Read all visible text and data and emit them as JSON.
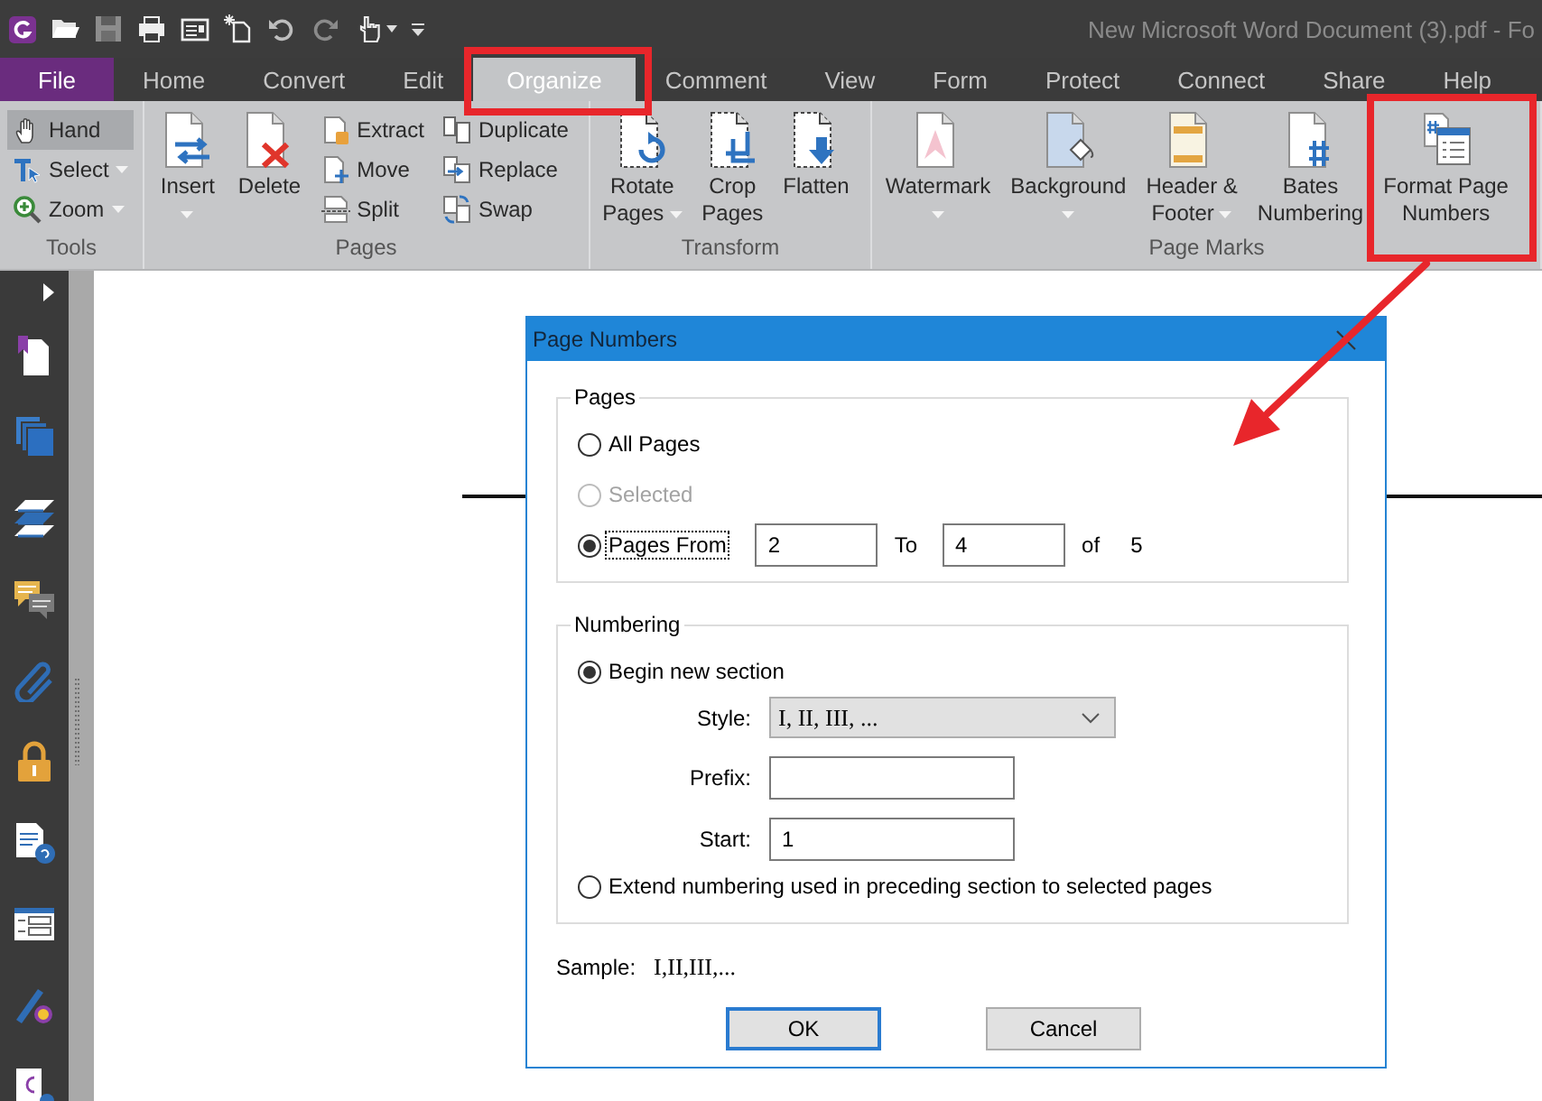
{
  "window": {
    "title": "New Microsoft Word Document (3).pdf - Fo"
  },
  "menu_tabs": [
    {
      "label": "File",
      "kind": "file",
      "selected": false
    },
    {
      "label": "Home",
      "kind": "tab",
      "selected": false
    },
    {
      "label": "Convert",
      "kind": "tab",
      "selected": false
    },
    {
      "label": "Edit",
      "kind": "tab",
      "selected": false
    },
    {
      "label": "Organize",
      "kind": "tab",
      "selected": true
    },
    {
      "label": "Comment",
      "kind": "tab",
      "selected": false
    },
    {
      "label": "View",
      "kind": "tab",
      "selected": false
    },
    {
      "label": "Form",
      "kind": "tab",
      "selected": false
    },
    {
      "label": "Protect",
      "kind": "tab",
      "selected": false
    },
    {
      "label": "Connect",
      "kind": "tab",
      "selected": false
    },
    {
      "label": "Share",
      "kind": "tab",
      "selected": false
    },
    {
      "label": "Help",
      "kind": "tab",
      "selected": false
    }
  ],
  "ribbon": {
    "groups": [
      {
        "label": "Tools",
        "items": [
          {
            "kind": "small",
            "label": "Hand",
            "selected": true
          },
          {
            "kind": "small",
            "label": "Select",
            "selected": false,
            "dropdown": true
          },
          {
            "kind": "small",
            "label": "Zoom",
            "selected": false,
            "dropdown": true
          }
        ]
      },
      {
        "label": "Pages",
        "items": [
          {
            "kind": "large",
            "lines": [
              "Insert"
            ],
            "dropdown": true
          },
          {
            "kind": "large",
            "lines": [
              "Delete"
            ]
          },
          {
            "kind": "small",
            "label": "Extract"
          },
          {
            "kind": "small",
            "label": "Move"
          },
          {
            "kind": "small",
            "label": "Split"
          },
          {
            "kind": "small",
            "label": "Duplicate"
          },
          {
            "kind": "small",
            "label": "Replace"
          },
          {
            "kind": "small",
            "label": "Swap"
          }
        ]
      },
      {
        "label": "Transform",
        "items": [
          {
            "kind": "large",
            "lines": [
              "Rotate",
              "Pages"
            ],
            "dropdown": true
          },
          {
            "kind": "large",
            "lines": [
              "Crop",
              "Pages"
            ]
          },
          {
            "kind": "large",
            "lines": [
              "Flatten"
            ]
          }
        ]
      },
      {
        "label": "Page Marks",
        "items": [
          {
            "kind": "large",
            "lines": [
              "Watermark"
            ],
            "dropdown": true
          },
          {
            "kind": "large",
            "lines": [
              "Background"
            ],
            "dropdown": true
          },
          {
            "kind": "large",
            "lines": [
              "Header &",
              "Footer"
            ],
            "dropdown": true
          },
          {
            "kind": "large",
            "lines": [
              "Bates",
              "Numbering"
            ]
          },
          {
            "kind": "large",
            "lines": [
              "Format Page",
              "Numbers"
            ]
          }
        ]
      }
    ]
  },
  "dialog": {
    "title": "Page Numbers",
    "pages": {
      "legend": "Pages",
      "options": [
        {
          "kind": "plain",
          "label": "All Pages",
          "selected": false,
          "disabled": false,
          "focused": false
        },
        {
          "kind": "plain",
          "label": "Selected",
          "selected": false,
          "disabled": true,
          "focused": false
        },
        {
          "kind": "range",
          "label": "Pages From",
          "selected": true,
          "disabled": false,
          "focused": true,
          "from": "2",
          "to_label": "To",
          "to": "4",
          "of_label": "of",
          "total": "5"
        }
      ]
    },
    "numbering": {
      "legend": "Numbering",
      "options": [
        {
          "kind": "section",
          "label": "Begin new section",
          "selected": true,
          "fields": [
            {
              "kind": "select",
              "label": "Style:",
              "value": "I, II, III, ..."
            },
            {
              "kind": "text",
              "label": "Prefix:"
            },
            {
              "kind": "text",
              "label": "Start:",
              "value": "1"
            }
          ]
        },
        {
          "kind": "plain",
          "label": "Extend numbering used in preceding section to selected pages",
          "selected": false
        }
      ]
    },
    "sample": {
      "label": "Sample:",
      "value": "I,II,III,..."
    },
    "buttons": [
      {
        "label": "OK",
        "default": true
      },
      {
        "label": "Cancel",
        "default": false
      }
    ]
  }
}
